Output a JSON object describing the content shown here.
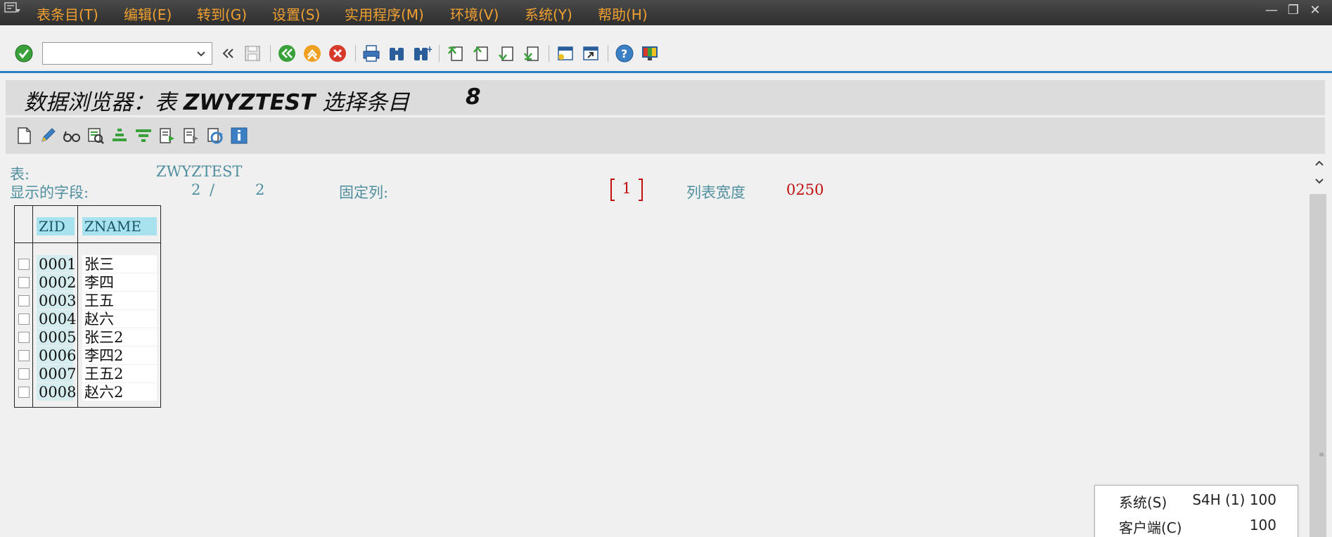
{
  "menu": {
    "items": [
      "表条目(T)",
      "编辑(E)",
      "转到(G)",
      "设置(S)",
      "实用程序(M)",
      "环境(V)",
      "系统(Y)",
      "帮助(H)"
    ]
  },
  "window_controls": {
    "minimize": "—",
    "restore": "❐",
    "close": "✕"
  },
  "command_field": {
    "value": ""
  },
  "title": {
    "prefix": "数据浏览器：表 ",
    "table": "ZWYZTEST",
    "suffix": " 选择条目",
    "count": "8"
  },
  "header": {
    "table_label": "表:",
    "table_value": "ZWYZTEST",
    "fields_label": "显示的字段:",
    "fields_shown": "2",
    "fields_sep": "/",
    "fields_total": "2",
    "fixed_label": "固定列:",
    "fixed_value": "1",
    "width_label": "列表宽度",
    "width_value": "0250"
  },
  "grid": {
    "columns": [
      "ZID",
      "ZNAME"
    ],
    "rows": [
      {
        "zid": "0001",
        "zname": "张三"
      },
      {
        "zid": "0002",
        "zname": "李四"
      },
      {
        "zid": "0003",
        "zname": "王五"
      },
      {
        "zid": "0004",
        "zname": "赵六"
      },
      {
        "zid": "0005",
        "zname": "张三2"
      },
      {
        "zid": "0006",
        "zname": "李四2"
      },
      {
        "zid": "0007",
        "zname": "王五2"
      },
      {
        "zid": "0008",
        "zname": "赵六2"
      }
    ]
  },
  "status": {
    "system_label": "系统(S)",
    "system_value": "S4H (1) 100",
    "client_label": "客户端(C)",
    "client_value": "100"
  },
  "colors": {
    "accent": "#2a7ec2",
    "menu_text": "#f0a030",
    "label_teal": "#4f8f9f",
    "value_red": "#c01010",
    "header_cyan": "#a8e2ef"
  }
}
